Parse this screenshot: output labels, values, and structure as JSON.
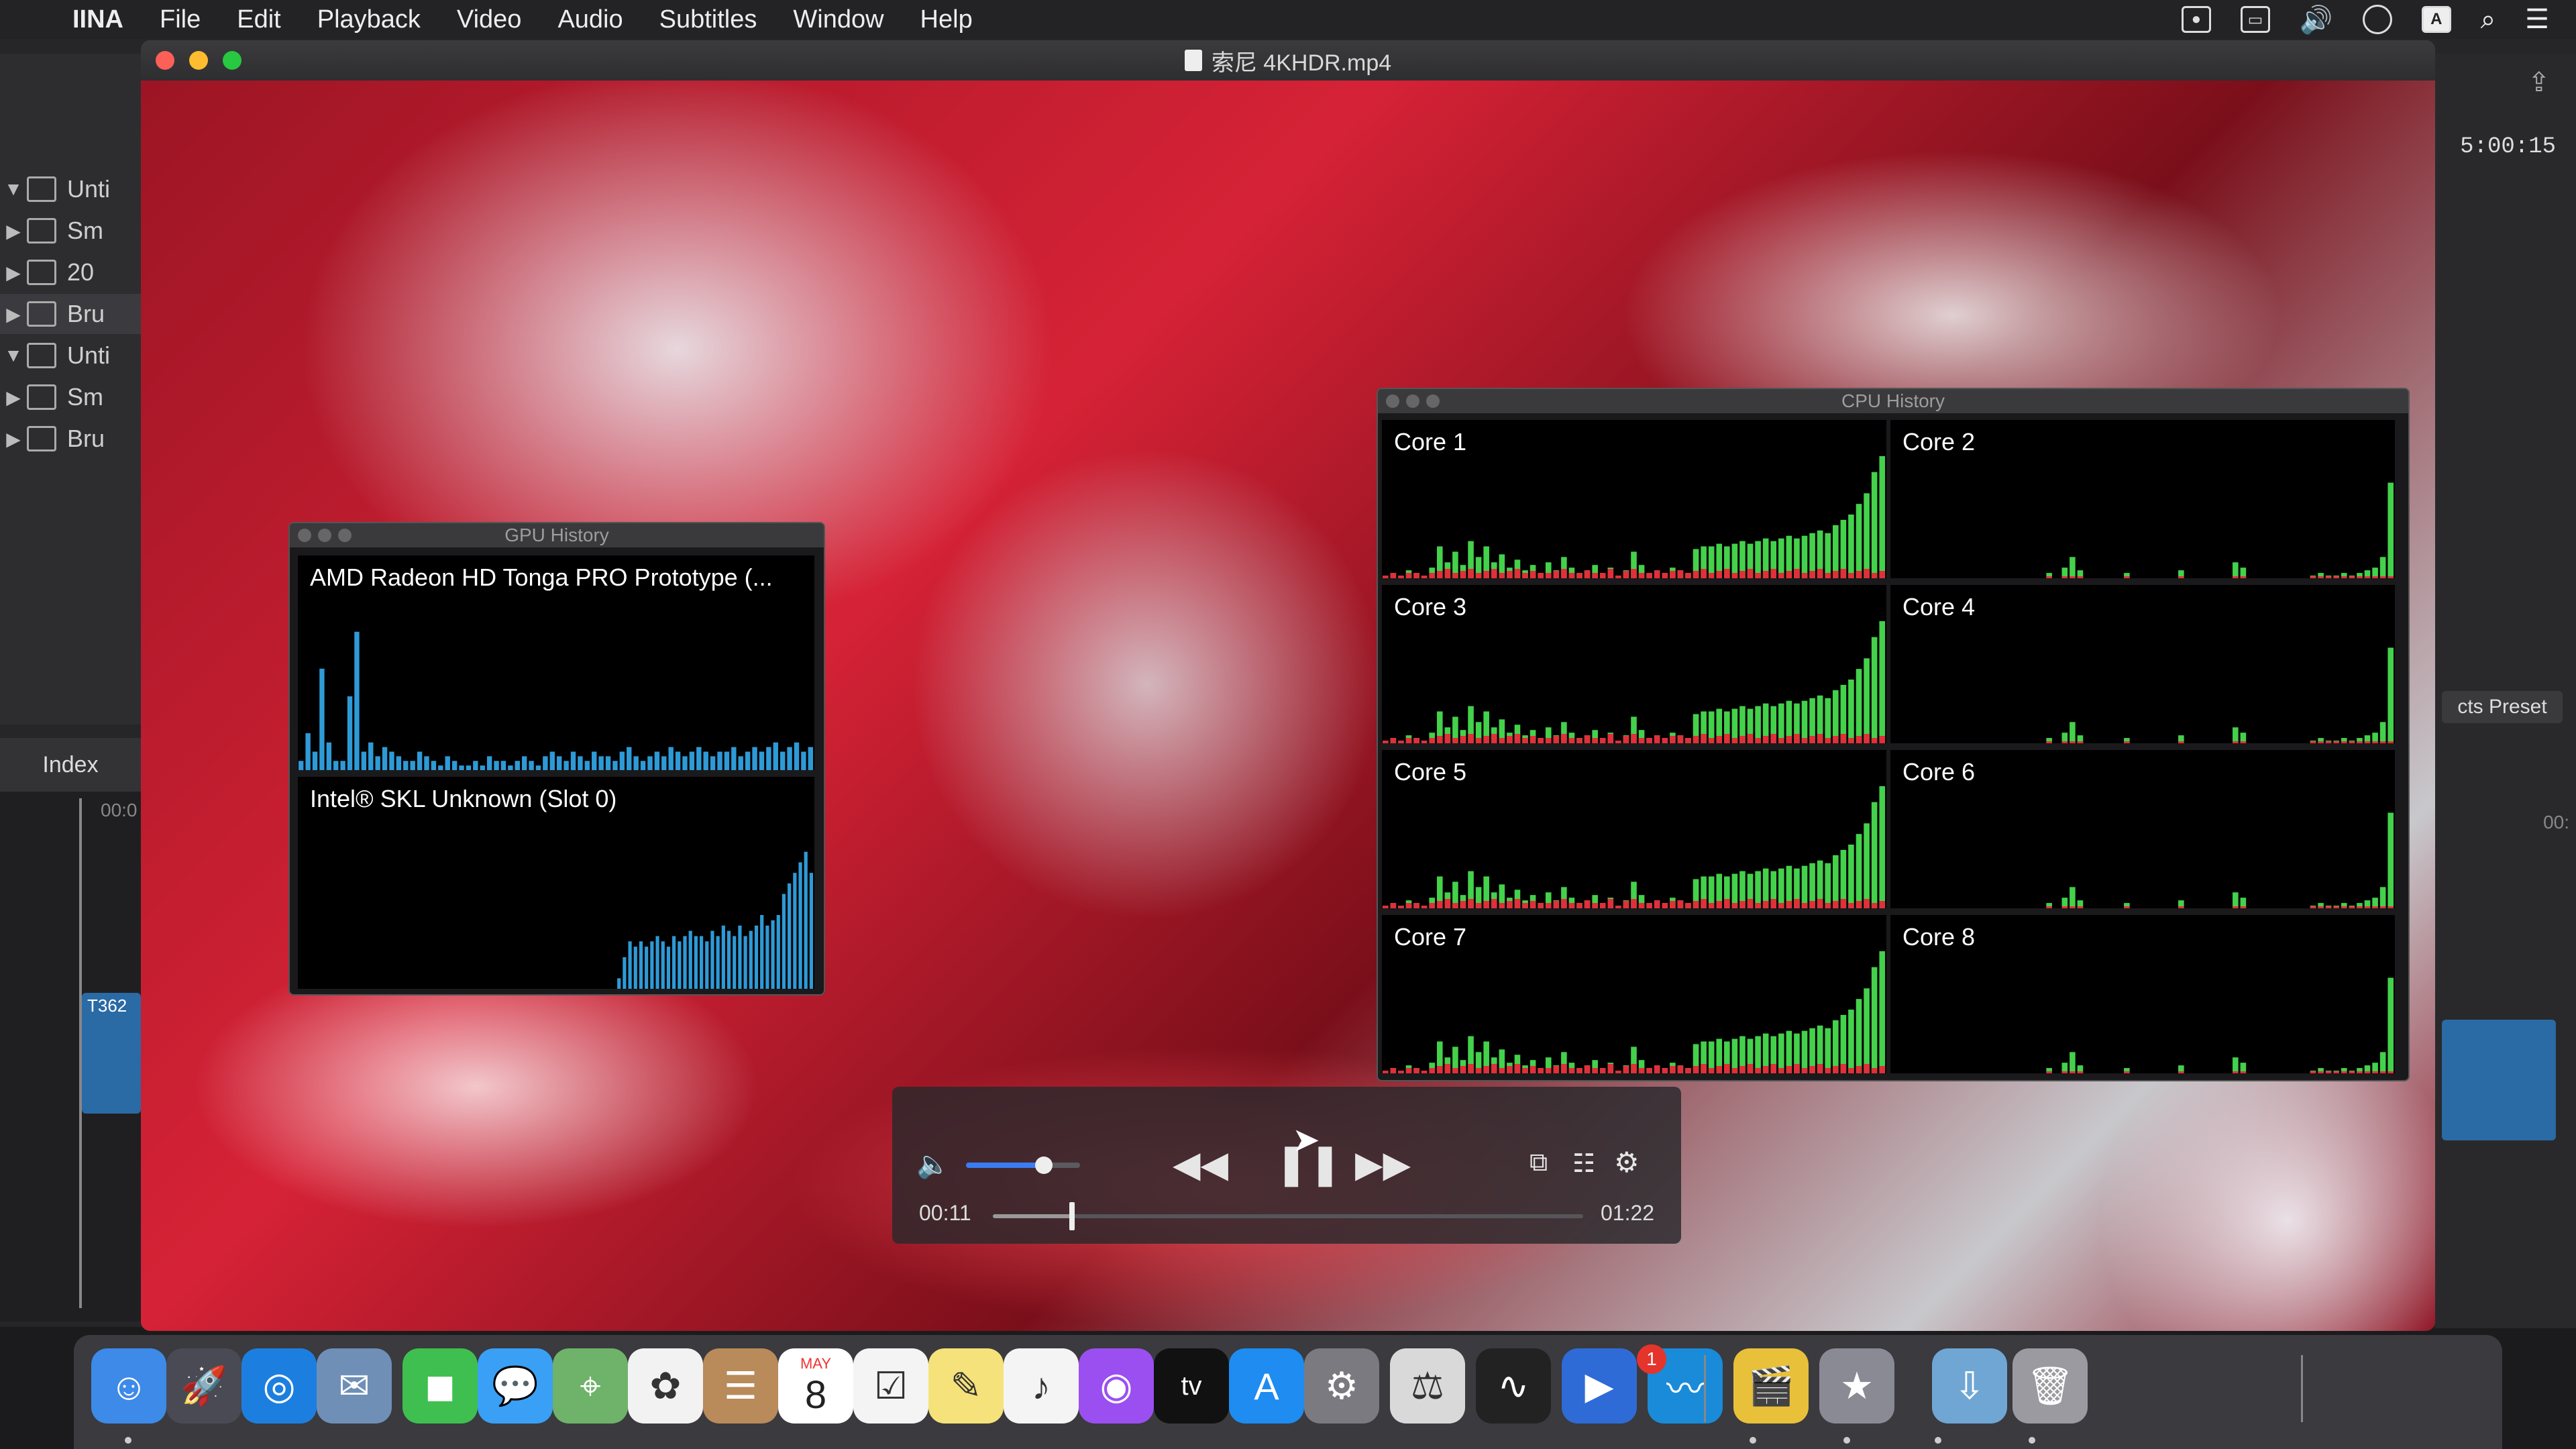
{
  "menubar": {
    "app_name": "IINA",
    "items": [
      "File",
      "Edit",
      "Playback",
      "Video",
      "Audio",
      "Subtitles",
      "Window",
      "Help"
    ],
    "input_source": "A"
  },
  "background_app": {
    "sidebar_rows": [
      {
        "label": "Unti",
        "icon": "library-grid-icon",
        "expanded": true
      },
      {
        "label": "Sm",
        "icon": "folder-icon",
        "expanded": false
      },
      {
        "label": "20",
        "icon": "star-event-icon",
        "expanded": false
      },
      {
        "label": "Bru",
        "icon": "star-event-icon",
        "expanded": false
      },
      {
        "label": "Unti",
        "icon": "library-grid-icon",
        "expanded": true
      },
      {
        "label": "Sm",
        "icon": "folder-icon",
        "expanded": false
      },
      {
        "label": "Bru",
        "icon": "star-event-icon",
        "expanded": false
      }
    ],
    "index_label": "Index",
    "timecode": "5:00:15",
    "timeline_left_time": "00:0",
    "timeline_right_time": "00:",
    "clip_label": "T362",
    "preset_button": "cts Preset"
  },
  "player": {
    "title": "索尼 4KHDR.mp4",
    "current_time": "00:11",
    "duration": "01:22",
    "volume": 0.68,
    "progress": 0.134
  },
  "gpu_history": {
    "title": "GPU History",
    "panels": [
      {
        "label": "AMD Radeon HD Tonga PRO Prototype (...",
        "values": [
          2,
          8,
          4,
          22,
          6,
          2,
          2,
          16,
          30,
          4,
          6,
          3,
          5,
          4,
          3,
          2,
          2,
          4,
          3,
          2,
          1,
          3,
          2,
          1,
          1,
          2,
          1,
          3,
          2,
          2,
          1,
          2,
          3,
          2,
          1,
          3,
          4,
          3,
          2,
          4,
          3,
          2,
          4,
          3,
          3,
          2,
          4,
          5,
          3,
          2,
          3,
          4,
          3,
          5,
          4,
          3,
          4,
          5,
          4,
          3,
          4,
          4,
          5,
          3,
          4,
          5,
          4,
          5,
          6,
          4,
          5,
          6,
          4,
          5
        ],
        "color": "#2e9ad6"
      },
      {
        "label": "Intel® SKL Unknown (Slot 0)",
        "values": [
          0,
          0,
          0,
          0,
          0,
          0,
          0,
          0,
          0,
          0,
          0,
          0,
          0,
          0,
          0,
          0,
          0,
          0,
          0,
          0,
          0,
          0,
          0,
          0,
          0,
          0,
          0,
          0,
          0,
          0,
          0,
          0,
          0,
          0,
          0,
          0,
          0,
          0,
          0,
          0,
          0,
          0,
          0,
          0,
          0,
          0,
          0,
          0,
          0,
          0,
          0,
          0,
          0,
          0,
          0,
          0,
          0,
          0,
          2,
          6,
          9,
          8,
          9,
          8,
          9,
          10,
          9,
          8,
          10,
          9,
          10,
          11,
          10,
          10,
          9,
          11,
          10,
          12,
          11,
          10,
          12,
          10,
          11,
          12,
          14,
          12,
          13,
          14,
          18,
          20,
          22,
          24,
          26,
          22
        ],
        "color": "#2e9ad6"
      }
    ]
  },
  "cpu_history": {
    "title": "CPU History",
    "cores": [
      {
        "label": "Core 1",
        "pattern": "busy"
      },
      {
        "label": "Core 2",
        "pattern": "idle"
      },
      {
        "label": "Core 3",
        "pattern": "busy"
      },
      {
        "label": "Core 4",
        "pattern": "idle"
      },
      {
        "label": "Core 5",
        "pattern": "busy"
      },
      {
        "label": "Core 6",
        "pattern": "idle"
      },
      {
        "label": "Core 7",
        "pattern": "busy"
      },
      {
        "label": "Core 8",
        "pattern": "idle"
      }
    ],
    "user_color": "#44d14b",
    "system_color": "#e0303a"
  },
  "dock": {
    "calendar_month": "MAY",
    "calendar_day": "8",
    "preferences_badge": "1",
    "apps": [
      "finder-icon",
      "launchpad-icon",
      "safari-icon",
      "mail-icon",
      "facetime-icon",
      "messages-icon",
      "maps-icon",
      "photos-icon",
      "contacts-icon",
      "calendar-icon",
      "reminders-icon",
      "notes-icon",
      "music-icon",
      "podcasts-icon",
      "tv-icon",
      "app-store-icon",
      "system-preferences-icon",
      "instruments-icon",
      "activity-monitor-icon",
      "iina-icon",
      "intel-power-gadget-icon",
      "final-cut-icon",
      "motion-icon",
      "downloads-folder-icon",
      "trash-icon"
    ]
  }
}
